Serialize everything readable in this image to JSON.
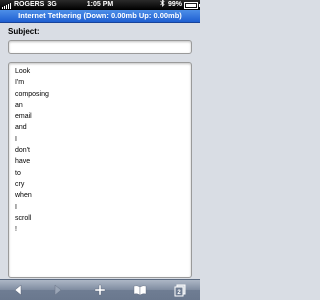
{
  "status_bar": {
    "carrier": "ROGERS",
    "network": "3G",
    "time": "1:05 PM",
    "battery_percent": "99%",
    "battery_level": 0.99,
    "bluetooth_icon": "bluetooth-icon"
  },
  "tethering_bar": {
    "text": "Internet Tethering (Down: 0.00mb Up: 0.00mb)"
  },
  "form": {
    "subject_label": "Subject:",
    "subject_value": "",
    "body_lines": [
      "Look",
      "I'm",
      "composing",
      "an",
      "email",
      "and",
      "I",
      "don't",
      "have",
      "to",
      "cry",
      "when",
      "I",
      "scroll",
      "!"
    ]
  },
  "toolbar": {
    "icons": [
      "back-arrow-icon",
      "forward-arrow-icon",
      "plus-icon",
      "bookmarks-icon",
      "pages-icon"
    ],
    "pages_count": "2"
  },
  "colors": {
    "tether_bar": "#2f6fe0",
    "background": "#d9dde4",
    "toolbar": "#7f8ca0"
  }
}
